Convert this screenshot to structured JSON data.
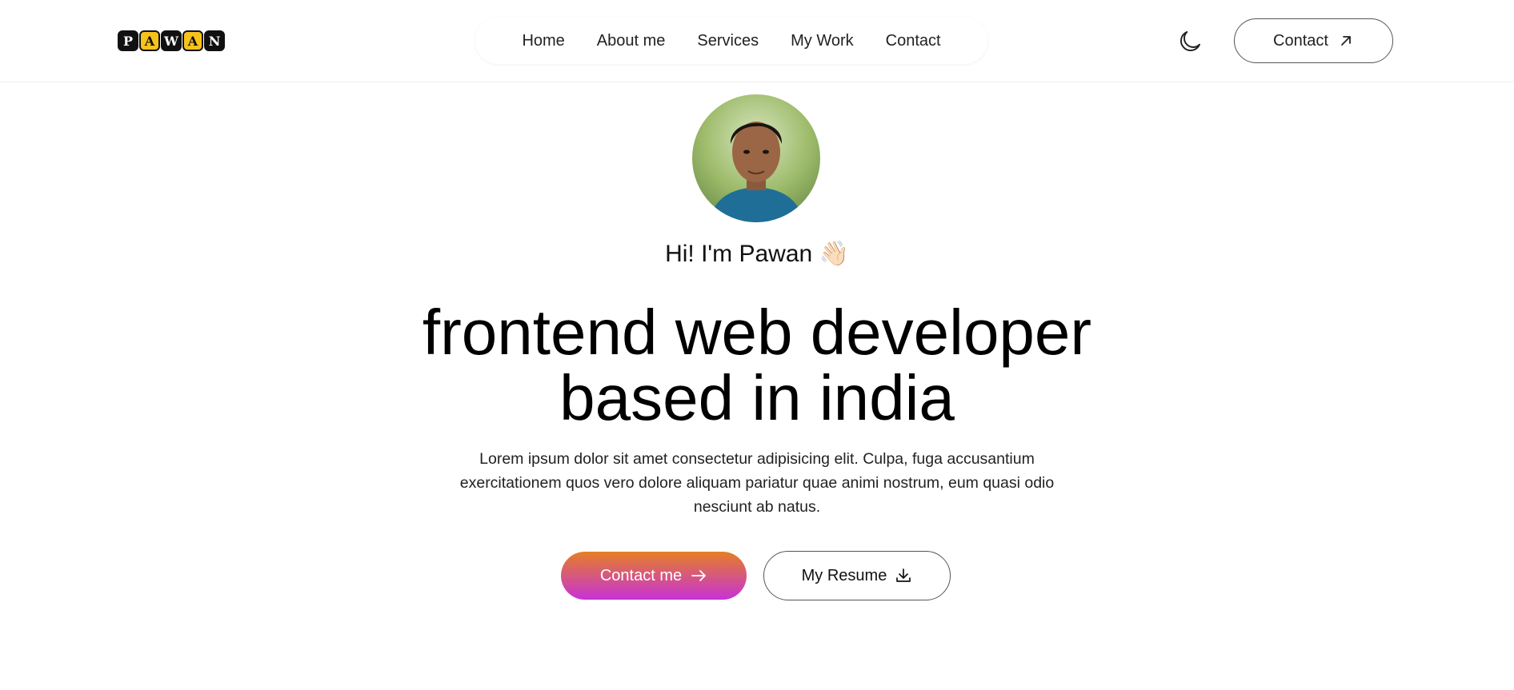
{
  "header": {
    "logo_letters": [
      "P",
      "A",
      "W",
      "A",
      "N"
    ],
    "nav": [
      "Home",
      "About me",
      "Services",
      "My Work",
      "Contact"
    ],
    "theme_icon": "moon-icon",
    "contact_label": "Contact",
    "contact_icon": "arrow-up-right-icon"
  },
  "hero": {
    "greeting": "Hi! I'm Pawan",
    "greeting_emoji": "👋🏻",
    "headline_line1": "frontend web developer",
    "headline_line2": "based in india",
    "description": "Lorem ipsum dolor sit amet consectetur adipisicing elit. Culpa, fuga accusantium exercitationem quos vero dolore aliquam pariatur quae animi nostrum, eum quasi odio nesciunt ab natus.",
    "primary_button": "Contact me",
    "secondary_button": "My Resume"
  },
  "colors": {
    "accent_gradient_start": "#e57f25",
    "accent_gradient_end": "#c832d6",
    "logo_yellow": "#f8c21c"
  }
}
